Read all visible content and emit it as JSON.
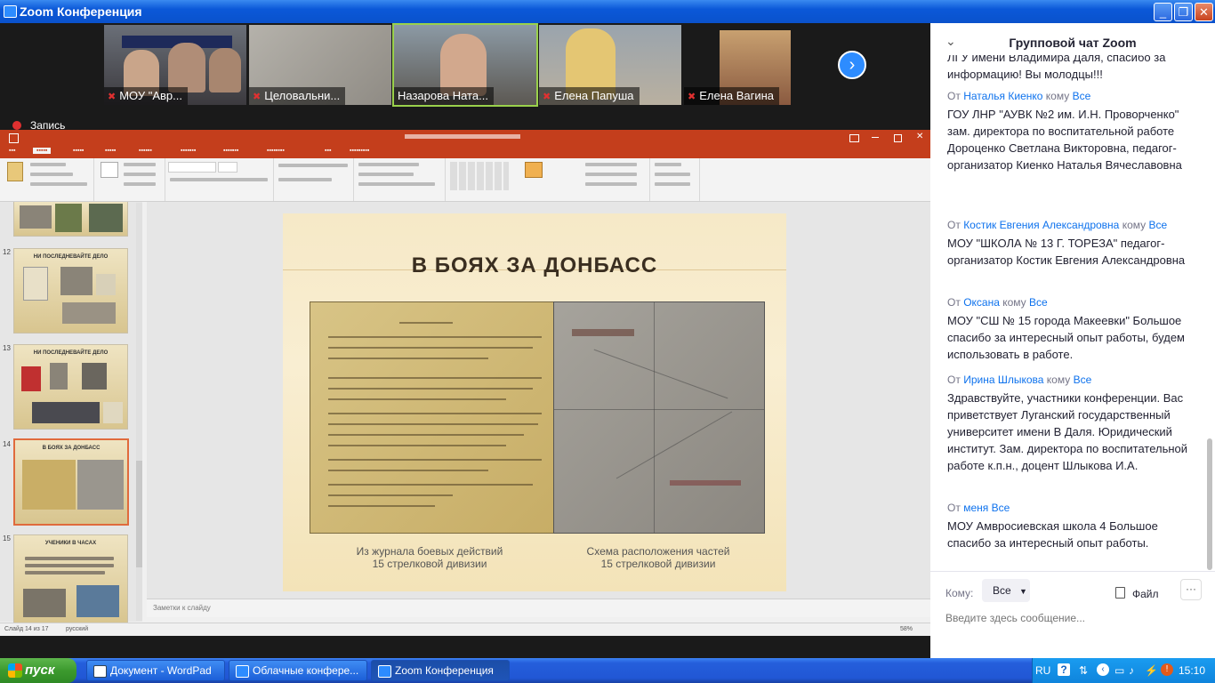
{
  "window": {
    "title": "Zoom Конференция"
  },
  "participants": [
    {
      "name": "МОУ \"Авр...",
      "muted": true
    },
    {
      "name": "Целовальни...",
      "muted": true
    },
    {
      "name": "Назарова Ната...",
      "muted": false
    },
    {
      "name": "Елена Папуша",
      "muted": true
    },
    {
      "name": "Елена Вагина",
      "muted": true
    }
  ],
  "recording": {
    "label": "Запись"
  },
  "powerpoint": {
    "title": "В БОЯХ ЗА ДОНБАСС",
    "slide_numbers": [
      "12",
      "13",
      "14",
      "15"
    ],
    "thumb_titles": [
      "НИ ПОСЛЕДНЕВАЙТЕ ДЕЛО",
      "НИ ПОСЛЕДНЕВАЙТЕ ДЕЛО",
      "В БОЯХ ЗА ДОНБАСС",
      "УЧЕНИКИ В ЧАСАХ"
    ],
    "caption_left": [
      "Из журнала боевых действий",
      "15 стрелковой дивизии"
    ],
    "caption_right": [
      "Схема расположения частей",
      "15 стрелковой дивизии"
    ],
    "notes_placeholder": "Заметки к слайду",
    "status_left": "Слайд 14 из 17",
    "status_lang": "русский",
    "zoom": "58%"
  },
  "chat": {
    "title": "Групповой чат Zoom",
    "messages": [
      {
        "from": "",
        "to": "",
        "body": "ЛГУ имени Владимира Даля, спасибо за информацию! Вы молодцы!!!"
      },
      {
        "from": "Наталья Киенко",
        "to": "Все",
        "body": "ГОУ ЛНР \"АУВК №2 им. И.Н. Проворченко\" зам. директора по воспитательной работе Дороценко Светлана Викторовна, педагог-организатор Киенко Наталья Вячеславовна"
      },
      {
        "from": "Костик Евгения Александровна",
        "to": "Все",
        "body": "МОУ \"ШКОЛА № 13 Г. ТОРЕЗА\" педагог-организатор Костик Евгения Александровна"
      },
      {
        "from": "Оксана",
        "to": "Все",
        "body": "МОУ \"СШ № 15 города Макеевки\" Большое спасибо за интересный опыт работы, будем использовать в работе."
      },
      {
        "from": "Ирина Шлыкова",
        "to": "Все",
        "body": "Здравствуйте, участники конференции. Вас приветствует Луганский государственный университет имени В Даля. Юридический институт. Зам. директора по воспитательной работе к.п.н., доцент Шлыкова И.А."
      },
      {
        "from": "меня",
        "to": "Все",
        "body": "МОУ Амвросиевская школа 4 Большое спасибо за интересный опыт работы."
      }
    ],
    "from_word": "От",
    "to_word": "кому",
    "to_label": "Кому:",
    "to_value": "Все",
    "file_label": "Файл",
    "more_label": "···",
    "input_placeholder": "Введите здесь сообщение..."
  },
  "taskbar": {
    "start": "пуск",
    "tasks": [
      "Документ - WordPad",
      "Облачные конфере...",
      "Zoom Конференция"
    ],
    "lang": "RU",
    "time": "15:10"
  },
  "colors": {
    "zoom_blue": "#2d8cff",
    "ppt_red": "#c43e1c",
    "xp_blue": "#245edb"
  }
}
